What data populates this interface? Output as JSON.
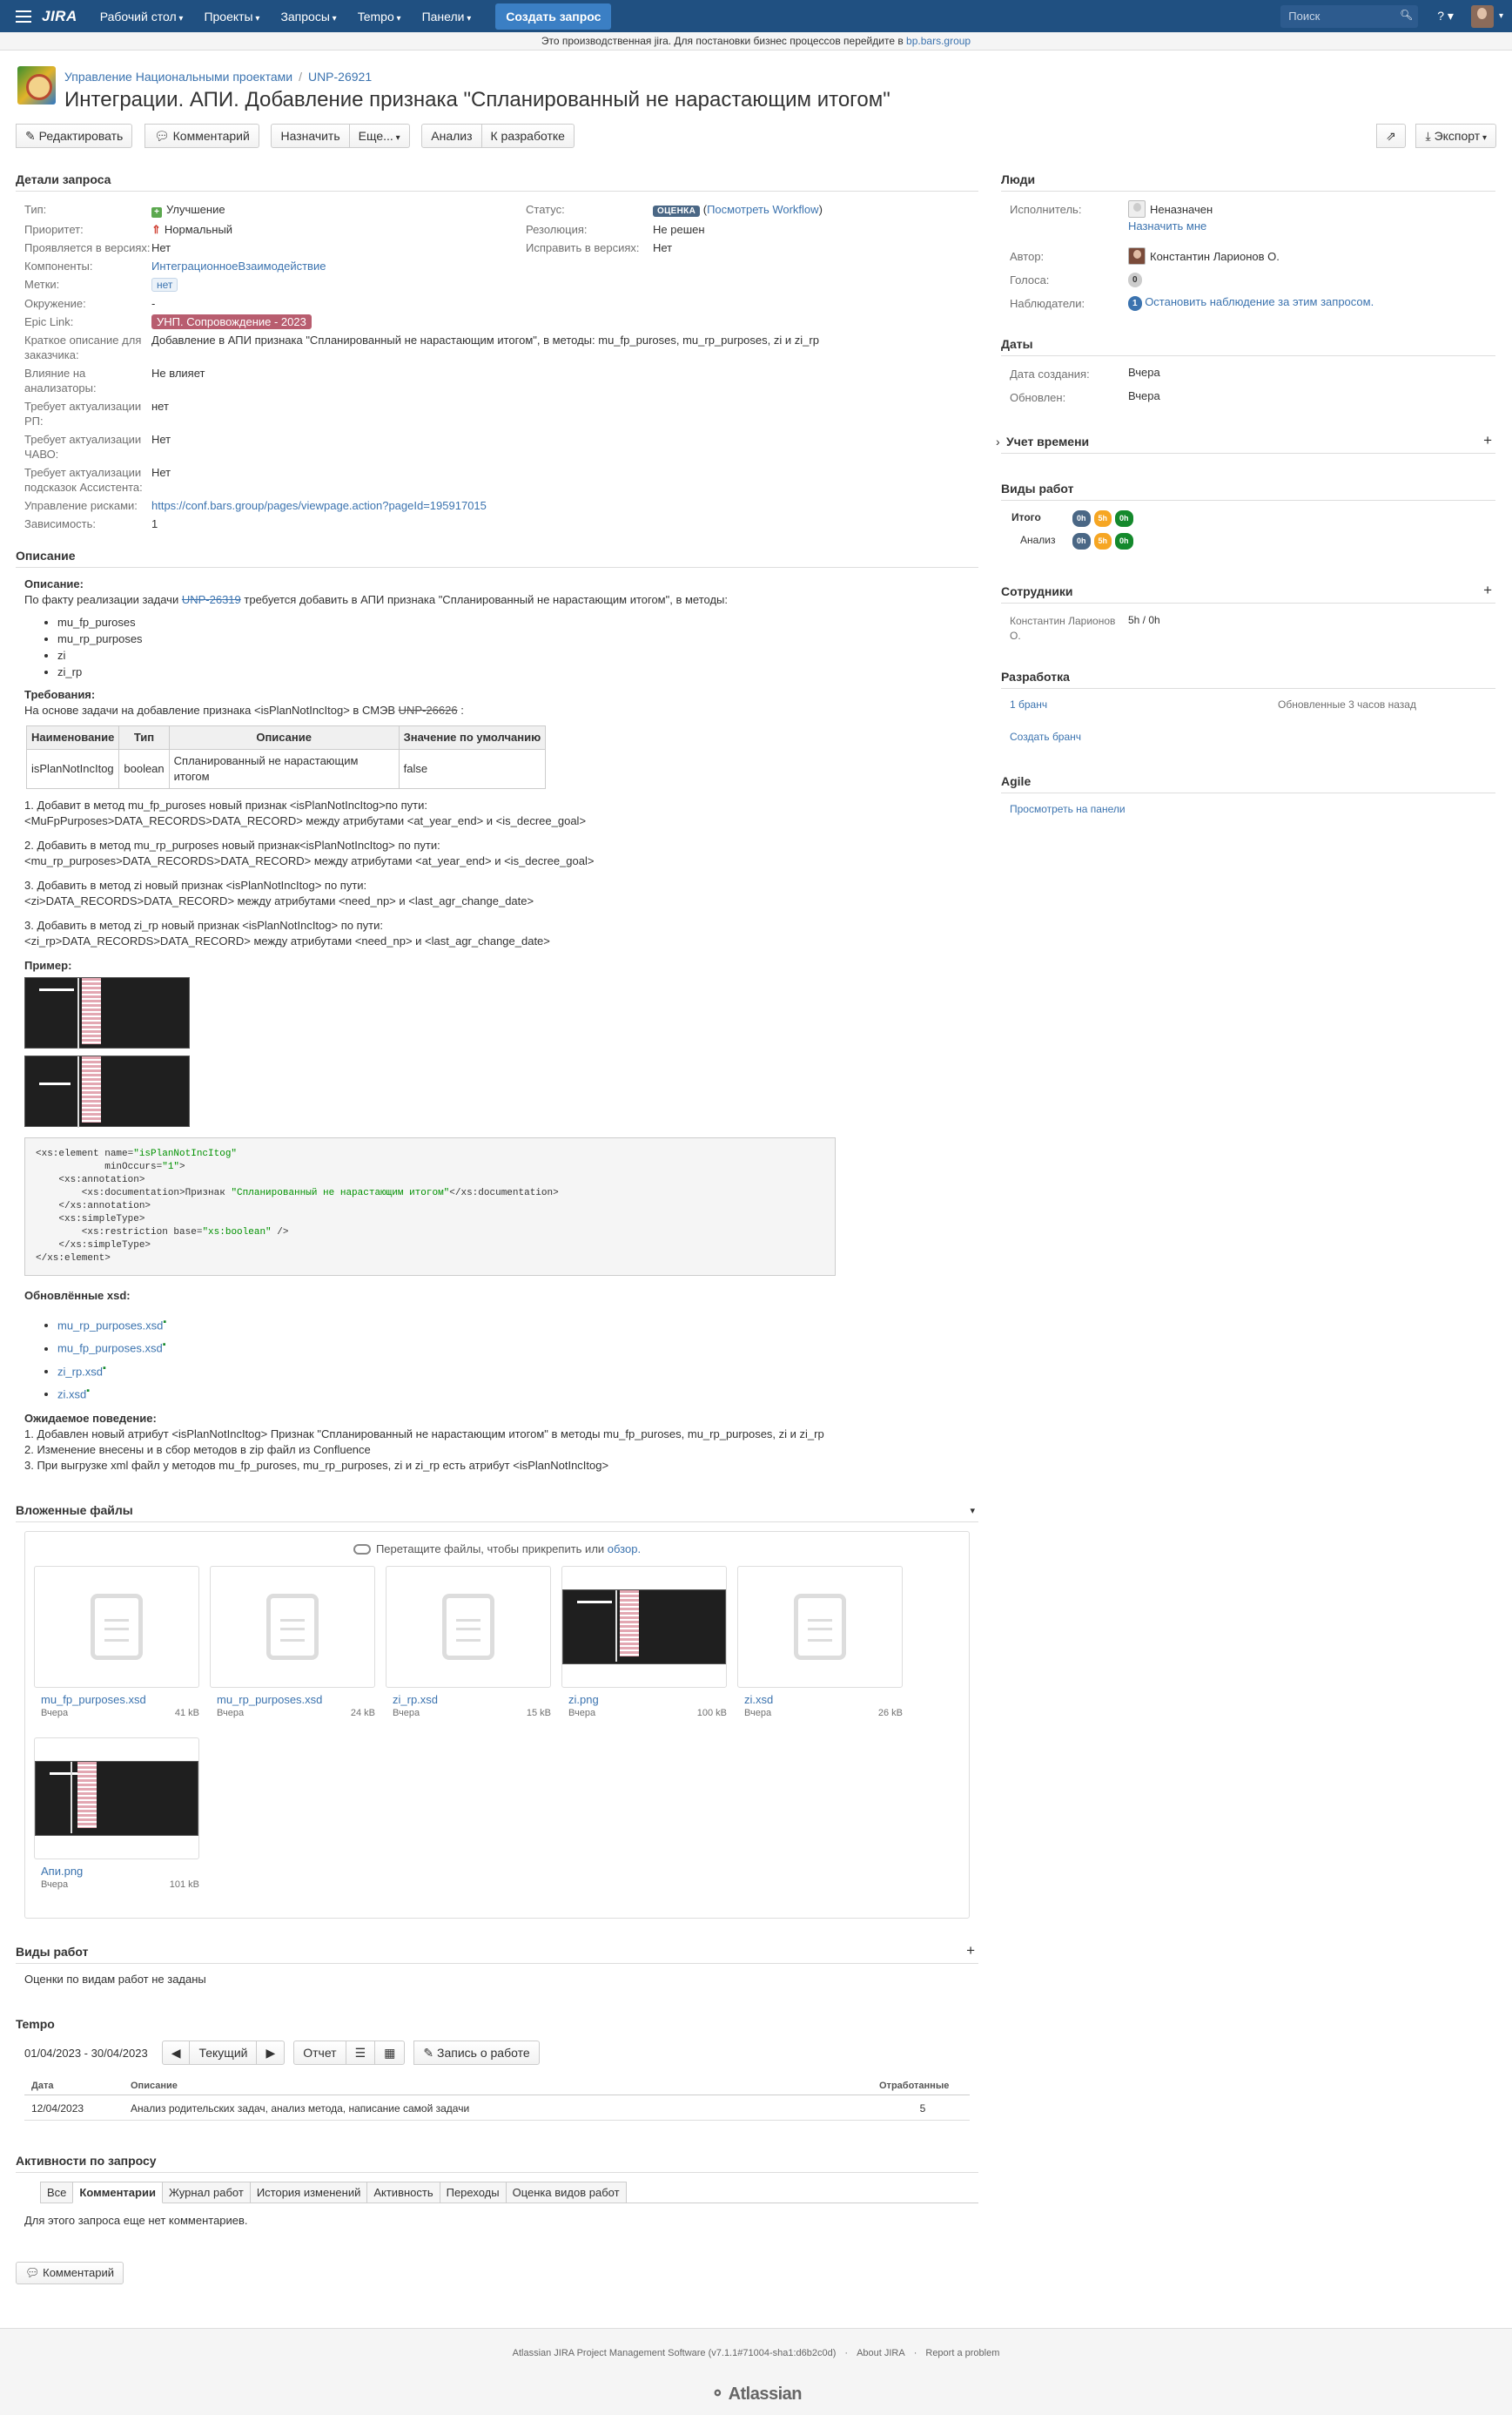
{
  "nav": {
    "logo": "JIRA",
    "menus": [
      "Рабочий стол",
      "Проекты",
      "Запросы",
      "Tempo",
      "Панели"
    ],
    "create": "Создать запрос",
    "search_placeholder": "Поиск",
    "help": "?"
  },
  "banner": {
    "text": "Это производственная jira. Для постановки бизнес процессов перейдите в ",
    "link": "bp.bars.group"
  },
  "issue": {
    "project": "Управление Национальными проектами",
    "key": "UNP-26921",
    "summary": "Интеграции. АПИ. Добавление признака \"Спланированный не нарастающим итогом\""
  },
  "toolbar": {
    "edit": "Редактировать",
    "comment": "Комментарий",
    "assign": "Назначить",
    "more": "Еще...",
    "analysis": "Анализ",
    "todev": "К разработке",
    "share": "",
    "export": "Экспорт"
  },
  "details": {
    "title": "Детали запроса",
    "type_lbl": "Тип:",
    "type": "Улучшение",
    "prio_lbl": "Приоритет:",
    "prio": "Нормальный",
    "affects_lbl": "Проявляется в версиях:",
    "affects": "Нет",
    "comp_lbl": "Компоненты:",
    "comp": "ИнтеграционноеВзаимодействие",
    "labels_lbl": "Метки:",
    "labels": "нет",
    "env_lbl": "Окружение:",
    "env": "-",
    "epic_lbl": "Epic Link:",
    "epic": "УНП. Сопровождение - 2023",
    "short_lbl": "Краткое описание для заказчика:",
    "short": "Добавление в АПИ признака \"Спланированный не нарастающим итогом\", в методы: mu_fp_puroses, mu_rp_purposes, zi и zi_rp",
    "infl_lbl": "Влияние на анализаторы:",
    "infl": "Не влияет",
    "rp_lbl": "Требует актуализации РП:",
    "rp": "нет",
    "chavo_lbl": "Требует актуализации ЧАВО:",
    "chavo": "Нет",
    "asst_lbl": "Требует актуализации подсказок Ассистента:",
    "asst": "Нет",
    "risk_lbl": "Управление рисками:",
    "risk": "https://conf.bars.group/pages/viewpage.action?pageId=195917015",
    "dep_lbl": "Зависимость:",
    "dep": "1",
    "status_lbl": "Статус:",
    "status": "ОЦЕНКА",
    "workflow": "Посмотреть Workflow",
    "res_lbl": "Резолюция:",
    "res": "Не решен",
    "fix_lbl": "Исправить в версиях:",
    "fix": "Нет"
  },
  "description": {
    "title": "Описание",
    "h1": "Описание:",
    "p1a": "По факту реализации задачи ",
    "p1link": "UNP-26319",
    "p1b": " требуется добавить в АПИ признака \"Спланированный не нарастающим итогом\", в методы:",
    "methods": [
      "mu_fp_puroses",
      "mu_rp_purposes",
      "zi",
      "zi_rp"
    ],
    "h2": "Требования:",
    "p2a": "На основе задачи на добавление признака <isPlanNotIncItog> в СМЭВ ",
    "p2link": "UNP-26626",
    "table_headers": [
      "Наименование",
      "Тип",
      "Описание",
      "Значение по умолчанию"
    ],
    "table_row": [
      "isPlanNotIncItog",
      "boolean",
      "Спланированный не нарастающим итогом",
      "false"
    ],
    "steps": [
      [
        "1. Добавит в метод mu_fp_puroses новый признак <isPlanNotIncItog>по пути:",
        "<MuFpPurposes>DATA_RECORDS>DATA_RECORD> между атрибутами <at_year_end> и <is_decree_goal>"
      ],
      [
        "2. Добавить в метод mu_rp_purposes новый признак<isPlanNotIncItog> по пути:",
        "<mu_rp_purposes>DATA_RECORDS>DATA_RECORD> между атрибутами <at_year_end> и <is_decree_goal>"
      ],
      [
        "3. Добавить в метод zi новый признак <isPlanNotIncItog> по пути:",
        "<zi>DATA_RECORDS>DATA_RECORD> между атрибутами <need_np> и <last_agr_change_date>"
      ],
      [
        "3. Добавить в метод zi_rp новый признак <isPlanNotIncItog> по пути:",
        "<zi_rp>DATA_RECORDS>DATA_RECORD> между атрибутами <need_np> и <last_agr_change_date>"
      ]
    ],
    "h3": "Пример:",
    "code": {
      "l1a": "<xs:element name=",
      "l1s": "\"isPlanNotIncItog\"",
      "l2a": "            minOccurs=",
      "l2s": "\"1\"",
      "l2b": ">",
      "l3": "    <xs:annotation>",
      "l4a": "        <xs:documentation>Признак ",
      "l4s": "\"Спланированный не нарастающим итогом\"",
      "l4b": "</xs:documentation>",
      "l5": "    </xs:annotation>",
      "l6": "    <xs:simpleType>",
      "l7a": "        <xs:restriction base=",
      "l7s": "\"xs:boolean\"",
      "l7b": " />",
      "l8": "    </xs:simpleType>",
      "l9": "</xs:element>"
    },
    "h4": "Обновлённые xsd:",
    "xsd": [
      "mu_rp_purposes.xsd",
      "mu_fp_purposes.xsd",
      "zi_rp.xsd",
      "zi.xsd"
    ],
    "h5": "Ожидаемое поведение:",
    "expected": [
      "1. Добавлен новый атрибут <isPlanNotIncItog> Признак \"Спланированный не нарастающим итогом\" в методы mu_fp_puroses, mu_rp_purposes, zi и zi_rp",
      "2. Изменение внесены и в сбор методов в zip файл из Confluence",
      "3. При выгрузке xml файл у методов mu_fp_puroses, mu_rp_purposes, zi и zi_rp есть атрибут <isPlanNotIncItog>"
    ]
  },
  "attachments": {
    "title": "Вложенные файлы",
    "drop": "Перетащите файлы, чтобы прикрепить или ",
    "browse": "обзор.",
    "files": [
      {
        "name": "mu_fp_purposes.xsd",
        "date": "Вчера",
        "size": "41 kB",
        "image": false
      },
      {
        "name": "mu_rp_purposes.xsd",
        "date": "Вчера",
        "size": "24 kB",
        "image": false
      },
      {
        "name": "zi_rp.xsd",
        "date": "Вчера",
        "size": "15 kB",
        "image": false
      },
      {
        "name": "zi.png",
        "date": "Вчера",
        "size": "100 kB",
        "image": true
      },
      {
        "name": "zi.xsd",
        "date": "Вчера",
        "size": "26 kB",
        "image": false
      },
      {
        "name": "Апи.png",
        "date": "Вчера",
        "size": "101 kB",
        "image": true
      }
    ]
  },
  "worktypes": {
    "title": "Виды работ",
    "text": "Оценки по видам работ не заданы"
  },
  "tempo": {
    "title": "Tempo",
    "range": "01/04/2023 - 30/04/2023",
    "current": "Текущий",
    "report": "Отчет",
    "log": "Запись о работе",
    "headers": [
      "Дата",
      "Описание",
      "Отработанные"
    ],
    "row": [
      "12/04/2023",
      "Анализ родительских задач, анализ метода, написание самой задачи",
      "5"
    ]
  },
  "activity": {
    "title": "Активности по запросу",
    "tabs": [
      "Все",
      "Комментарии",
      "Журнал работ",
      "История изменений",
      "Активность",
      "Переходы",
      "Оценка видов работ"
    ],
    "empty": "Для этого запроса еще нет комментариев.",
    "comment_btn": "Комментарий"
  },
  "people": {
    "title": "Люди",
    "assignee_lbl": "Исполнитель:",
    "assignee": "Неназначен",
    "assign_me": "Назначить мне",
    "reporter_lbl": "Автор:",
    "reporter": "Константин Ларионов О.",
    "votes_lbl": "Голоса:",
    "votes": "0",
    "watchers_lbl": "Наблюдатели:",
    "watchers": "1",
    "watch_text": "Остановить наблюдение за этим запросом."
  },
  "dates": {
    "title": "Даты",
    "created_lbl": "Дата создания:",
    "created": "Вчера",
    "updated_lbl": "Обновлен:",
    "updated": "Вчера"
  },
  "timetracking": {
    "title": "Учет времени"
  },
  "worktypes_side": {
    "title": "Виды работ",
    "total": "Итого",
    "analysis": "Анализ",
    "b1": "0h",
    "b2": "5h",
    "b3": "0h"
  },
  "staff": {
    "title": "Сотрудники",
    "name": "Константин Ларионов О.",
    "hours": "5h / 0h"
  },
  "dev": {
    "title": "Разработка",
    "branch": "1 бранч",
    "updated": "Обновленные 3 часов назад",
    "create": "Создать бранч"
  },
  "agile": {
    "title": "Agile",
    "link": "Просмотреть на панели"
  },
  "footer": {
    "text": "Atlassian JIRA Project Management Software (v7.1.1#71004-sha1:d6b2c0d)",
    "about": "About JIRA",
    "report": "Report a problem",
    "logo": "Atlassian"
  },
  "colors": {
    "nav": "#205081",
    "link": "#3b73af",
    "epic": "#b85d6f",
    "status": "#4a6785"
  }
}
